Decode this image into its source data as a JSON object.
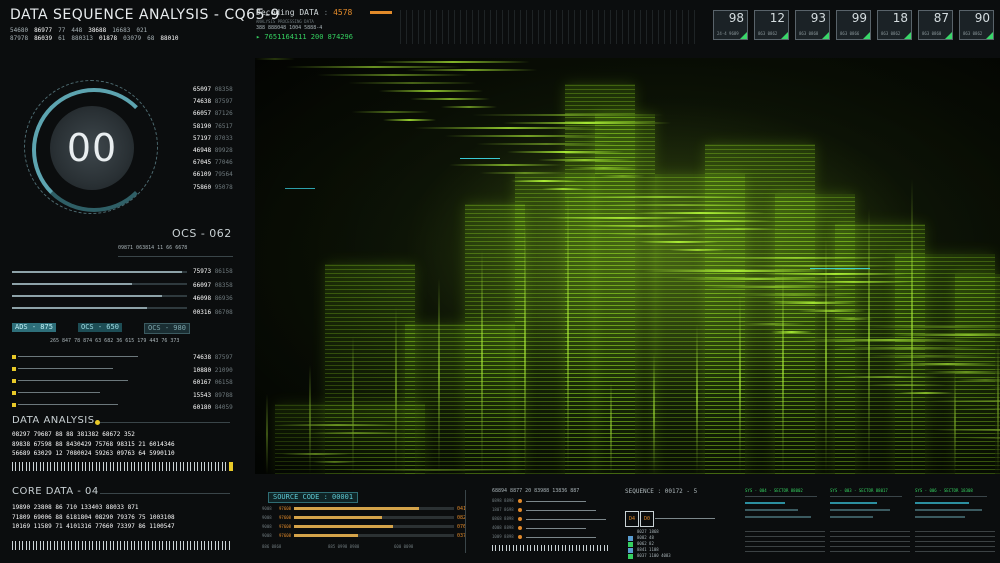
{
  "header": {
    "title": "DATA SEQUENCE ANALYSIS - CQ65-9",
    "code_rows": [
      [
        "54680",
        "86977",
        "77",
        "448",
        "38688",
        "16683",
        "021"
      ],
      [
        "87978",
        "86039",
        "61",
        "880313",
        "01878",
        "03079",
        "68",
        "88010"
      ]
    ],
    "decoding_label": "Decoding DATA",
    "decoding_sep": ":",
    "decoding_value": "4578",
    "processing_label": "ANALYSIS PROCESSING DATA",
    "processing_row": "388   888048   1004   5888-4",
    "stream": "▸ 7651164111 200 874296"
  },
  "stats": [
    {
      "value": "98",
      "sub": "24-4 9689"
    },
    {
      "value": "12",
      "sub": "863 0862"
    },
    {
      "value": "93",
      "sub": "863 0868"
    },
    {
      "value": "99",
      "sub": "863 0866"
    },
    {
      "value": "18",
      "sub": "863 0862"
    },
    {
      "value": "87",
      "sub": "863 0860"
    },
    {
      "value": "90",
      "sub": "863 0862"
    }
  ],
  "dial": {
    "value": "00"
  },
  "right_numbers_top": [
    [
      "65097",
      "08358"
    ],
    [
      "74638",
      "87597"
    ],
    [
      "66057",
      "87126"
    ],
    [
      "58190",
      "76517"
    ],
    [
      "57197",
      "87033"
    ],
    [
      "46948",
      "89928"
    ],
    [
      "67045",
      "77046"
    ],
    [
      "66109",
      "79564"
    ],
    [
      "75860",
      "95078"
    ]
  ],
  "ocs": {
    "label": "OCS - 062",
    "row": "09871   063814   11   66   6678"
  },
  "mid_numbers": [
    [
      "75973",
      "86158"
    ],
    [
      "66097",
      "08358"
    ],
    [
      "46098",
      "86936"
    ],
    [
      "00316",
      "86708"
    ]
  ],
  "tags": [
    "ADS - 875",
    "OCS - 650",
    "OCS - 980"
  ],
  "tag_row": "265 847   78  874     63 682   36  615     179 443   76  373",
  "lower_numbers": [
    [
      "74638",
      "87597"
    ],
    [
      "10880",
      "21090"
    ],
    [
      "60167",
      "06158"
    ],
    [
      "15543",
      "89788"
    ],
    [
      "60180",
      "84059"
    ]
  ],
  "data_analysis": {
    "label": "DATA ANALYSIS",
    "rows": [
      "08297   79687   88   88   381382   68672   352",
      "89838   67598   88   8430429   75768   98315   21   6014346",
      "56689   63029   12   7080024   59263   09763   64   5990110"
    ]
  },
  "core_data": {
    "label": "CORE DATA - 04",
    "rows": [
      "19890   23808   86   710   133403   88033   871",
      "71809   69006   88   6181804   08290   79376   75   1003108",
      "10169   11589   71   4101316   77660   73397   86   1100547"
    ]
  },
  "source_code": {
    "label": "SOURCE CODE : 00001",
    "rows": [
      {
        "id": "9008",
        "tag": "97608",
        "val": "041",
        "pct": 0.78
      },
      {
        "id": "9008",
        "tag": "97608",
        "val": "082",
        "pct": 0.55
      },
      {
        "id": "9008",
        "tag": "97608",
        "val": "076",
        "pct": 0.62
      },
      {
        "id": "9008",
        "tag": "97608",
        "val": "037",
        "pct": 0.4
      }
    ],
    "foot": [
      "886 0868",
      "885 0998 8988",
      "600 0098"
    ]
  },
  "mid_bottom": {
    "top_row": "68894   8877   20   83988   13836   887",
    "rows": [
      "0898 8898",
      "1807 8698",
      "0868 8898",
      "4008 8898",
      "1009 8898"
    ]
  },
  "sequence": {
    "label": "SEQUENCE : 00172 - 5",
    "chips": [
      "D4",
      "D0"
    ],
    "lines": [
      "8027 1868",
      "8082 48",
      "0062 82",
      "8841 1108",
      "8037 1100 4083"
    ]
  },
  "sectors": [
    {
      "label": "SYS - 004 - SECTOR 88002"
    },
    {
      "label": "SYS - 003 - SECTOR 88017"
    },
    {
      "label": "SYS - 006 - SECTOR 18308"
    }
  ],
  "colors": {
    "accent_green": "#35d060",
    "accent_cyan": "#5ec9d4",
    "accent_orange": "#e28a2a",
    "viz_green": "#a8f034"
  }
}
